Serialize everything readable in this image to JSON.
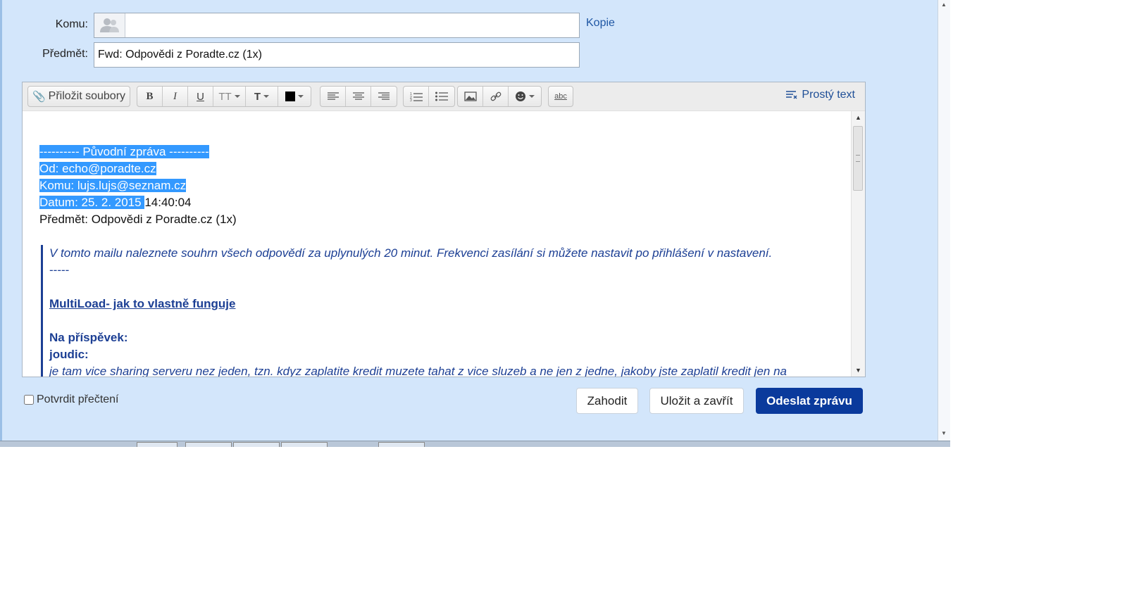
{
  "compose": {
    "to_label": "Komu:",
    "to_value": "",
    "kopie_label": "Kopie",
    "subject_label": "Předmět:",
    "subject_value": "Fwd: Odpovědi z Poradte.cz (1x)"
  },
  "toolbar": {
    "attach_label": "Přiložit soubory",
    "bold": "B",
    "italic": "I",
    "underline": "U",
    "font_size": "TT",
    "font_family": "T",
    "spellcheck": "abc",
    "plain_text_label": "Prostý text"
  },
  "body": {
    "header_lines": [
      "---------- Původní zpráva ----------",
      "Od: echo@poradte.cz",
      "Komu: lujs.lujs@seznam.cz",
      "Datum: 25. 2. 2015 ",
      "Předmět: Odpovědi z Poradte.cz (1x)"
    ],
    "date_time_rest": "14:40:04",
    "quote": {
      "intro": "V tomto mailu naleznete souhrn všech odpovědí za uplynulých 20 minut. Frekvenci zasílání si můžete nastavit po přihlášení v nastavení.",
      "separator": "-----",
      "link_title": "MultiLoad- jak to vlastně funguje",
      "on_post": "Na příspěvek:",
      "author": "joudic:",
      "text": "je tam vice sharing serveru nez jeden, tzn. kdyz zaplatite kredit muzete tahat z vice sluzeb a ne jen z jedne, jakoby jste zaplatil kredit jen na"
    }
  },
  "footer": {
    "confirm_read_label": "Potvrdit přečtení",
    "discard_label": "Zahodit",
    "save_close_label": "Uložit a zavřít",
    "send_label": "Odeslat zprávu"
  },
  "colors": {
    "page_bg": "#d3e6fb",
    "selection": "#3399ff",
    "quote_text": "#1c3f94",
    "send_button": "#0a3a9c"
  }
}
